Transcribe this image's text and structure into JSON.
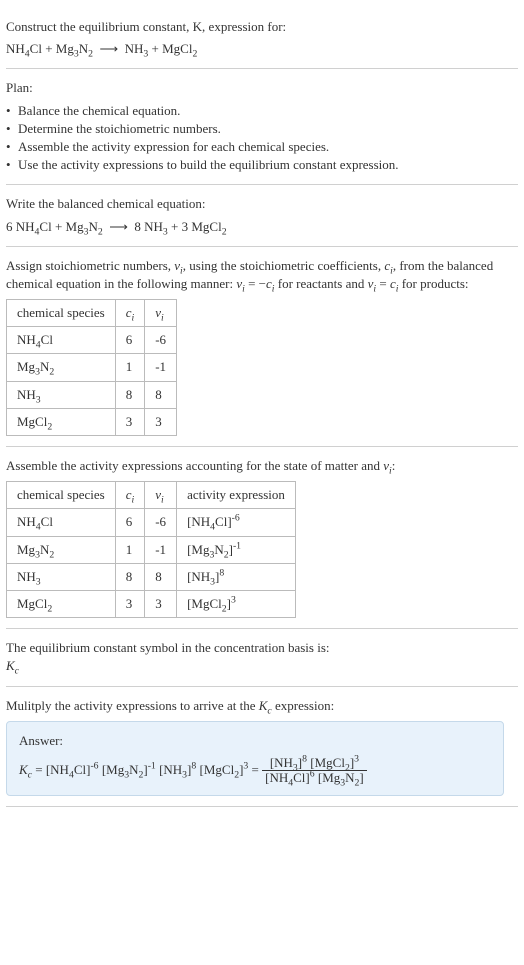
{
  "intro": {
    "title_line1": "Construct the equilibrium constant, K, expression for:",
    "eq_raw": "NH₄Cl + Mg₃N₂ ⟶ NH₃ + MgCl₂"
  },
  "plan": {
    "heading": "Plan:",
    "items": [
      "Balance the chemical equation.",
      "Determine the stoichiometric numbers.",
      "Assemble the activity expression for each chemical species.",
      "Use the activity expressions to build the equilibrium constant expression."
    ]
  },
  "balanced": {
    "heading": "Write the balanced chemical equation:",
    "eq_raw": "6 NH₄Cl + Mg₃N₂ ⟶ 8 NH₃ + 3 MgCl₂"
  },
  "stoich": {
    "intro_part1": "Assign stoichiometric numbers, ",
    "intro_part2": ", using the stoichiometric coefficients, ",
    "intro_part3": ", from the balanced chemical equation in the following manner: ",
    "intro_part4": " for reactants and ",
    "intro_part5": " for products:",
    "headers": {
      "h1": "chemical species",
      "h2": "cᵢ",
      "h3": "νᵢ"
    },
    "rows": [
      {
        "sp": "NH₄Cl",
        "c": "6",
        "v": "-6"
      },
      {
        "sp": "Mg₃N₂",
        "c": "1",
        "v": "-1"
      },
      {
        "sp": "NH₃",
        "c": "8",
        "v": "8"
      },
      {
        "sp": "MgCl₂",
        "c": "3",
        "v": "3"
      }
    ]
  },
  "activity": {
    "intro_part1": "Assemble the activity expressions accounting for the state of matter and ",
    "intro_part2": ":",
    "headers": {
      "h1": "chemical species",
      "h2": "cᵢ",
      "h3": "νᵢ",
      "h4": "activity expression"
    },
    "rows": [
      {
        "sp": "NH₄Cl",
        "c": "6",
        "v": "-6",
        "base": "[NH₄Cl]",
        "exp": "-6"
      },
      {
        "sp": "Mg₃N₂",
        "c": "1",
        "v": "-1",
        "base": "[Mg₃N₂]",
        "exp": "-1"
      },
      {
        "sp": "NH₃",
        "c": "8",
        "v": "8",
        "base": "[NH₃]",
        "exp": "8"
      },
      {
        "sp": "MgCl₂",
        "c": "3",
        "v": "3",
        "base": "[MgCl₂]",
        "exp": "3"
      }
    ]
  },
  "symbol": {
    "line1": "The equilibrium constant symbol in the concentration basis is:",
    "line2": "K꜀"
  },
  "final": {
    "heading": "Mulitply the activity expressions to arrive at the K꜀ expression:",
    "answer_label": "Answer:",
    "kc": "K꜀ = ",
    "lhs_terms": [
      {
        "base": "[NH₄Cl]",
        "exp": "-6"
      },
      {
        "base": "[Mg₃N₂]",
        "exp": "-1"
      },
      {
        "base": "[NH₃]",
        "exp": "8"
      },
      {
        "base": "[MgCl₂]",
        "exp": "3"
      }
    ],
    "eq_sign": " = ",
    "frac_num": [
      {
        "base": "[NH₃]",
        "exp": "8"
      },
      {
        "base": "[MgCl₂]",
        "exp": "3"
      }
    ],
    "frac_den": [
      {
        "base": "[NH₄Cl]",
        "exp": "6"
      },
      {
        "base": "[Mg₃N₂]",
        "exp": ""
      }
    ]
  }
}
